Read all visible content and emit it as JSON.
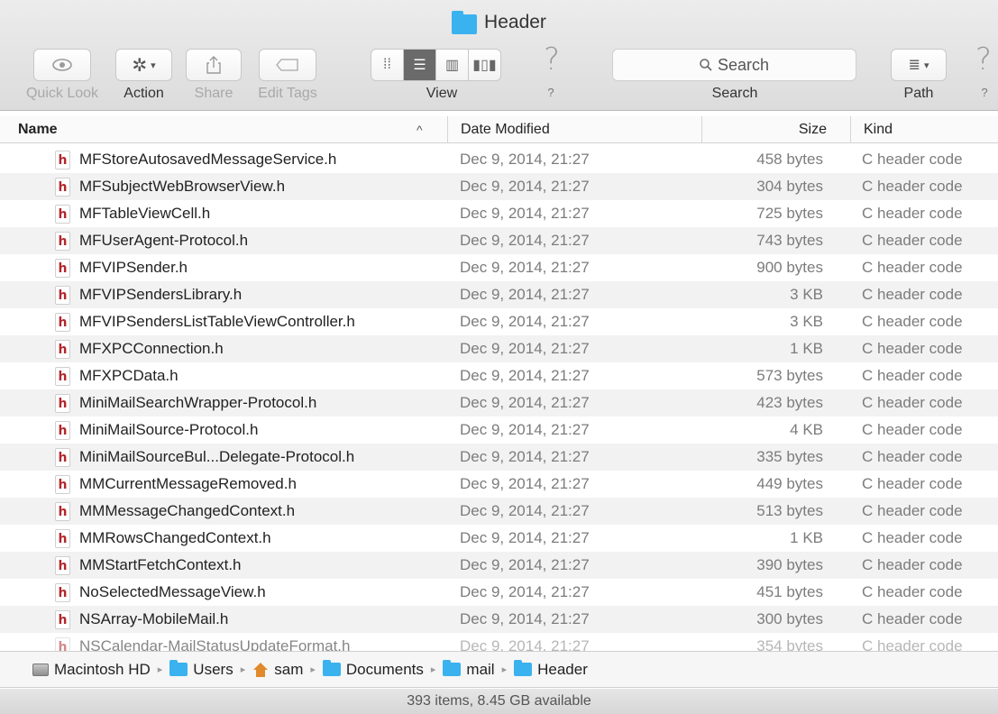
{
  "window": {
    "title": "Header"
  },
  "toolbar": {
    "quick_look_label": "Quick Look",
    "action_label": "Action",
    "share_label": "Share",
    "edit_tags_label": "Edit Tags",
    "view_label": "View",
    "help1_label": "?",
    "search_label": "Search",
    "search_placeholder": "Search",
    "path_label": "Path",
    "help2_label": "?",
    "view_modes": [
      "icon-view",
      "list-view",
      "column-view",
      "cover-flow-view"
    ],
    "active_view": "list-view"
  },
  "columns": {
    "name": "Name",
    "date_modified": "Date Modified",
    "size": "Size",
    "kind": "Kind"
  },
  "files": [
    {
      "name": "MFStoreAutosavedMessageService.h",
      "date": "Dec 9, 2014, 21:27",
      "size": "458 bytes",
      "kind": "C header code"
    },
    {
      "name": "MFSubjectWebBrowserView.h",
      "date": "Dec 9, 2014, 21:27",
      "size": "304 bytes",
      "kind": "C header code"
    },
    {
      "name": "MFTableViewCell.h",
      "date": "Dec 9, 2014, 21:27",
      "size": "725 bytes",
      "kind": "C header code"
    },
    {
      "name": "MFUserAgent-Protocol.h",
      "date": "Dec 9, 2014, 21:27",
      "size": "743 bytes",
      "kind": "C header code"
    },
    {
      "name": "MFVIPSender.h",
      "date": "Dec 9, 2014, 21:27",
      "size": "900 bytes",
      "kind": "C header code"
    },
    {
      "name": "MFVIPSendersLibrary.h",
      "date": "Dec 9, 2014, 21:27",
      "size": "3 KB",
      "kind": "C header code"
    },
    {
      "name": "MFVIPSendersListTableViewController.h",
      "date": "Dec 9, 2014, 21:27",
      "size": "3 KB",
      "kind": "C header code"
    },
    {
      "name": "MFXPCConnection.h",
      "date": "Dec 9, 2014, 21:27",
      "size": "1 KB",
      "kind": "C header code"
    },
    {
      "name": "MFXPCData.h",
      "date": "Dec 9, 2014, 21:27",
      "size": "573 bytes",
      "kind": "C header code"
    },
    {
      "name": "MiniMailSearchWrapper-Protocol.h",
      "date": "Dec 9, 2014, 21:27",
      "size": "423 bytes",
      "kind": "C header code"
    },
    {
      "name": "MiniMailSource-Protocol.h",
      "date": "Dec 9, 2014, 21:27",
      "size": "4 KB",
      "kind": "C header code"
    },
    {
      "name": "MiniMailSourceBul...Delegate-Protocol.h",
      "date": "Dec 9, 2014, 21:27",
      "size": "335 bytes",
      "kind": "C header code"
    },
    {
      "name": "MMCurrentMessageRemoved.h",
      "date": "Dec 9, 2014, 21:27",
      "size": "449 bytes",
      "kind": "C header code"
    },
    {
      "name": "MMMessageChangedContext.h",
      "date": "Dec 9, 2014, 21:27",
      "size": "513 bytes",
      "kind": "C header code"
    },
    {
      "name": "MMRowsChangedContext.h",
      "date": "Dec 9, 2014, 21:27",
      "size": "1 KB",
      "kind": "C header code"
    },
    {
      "name": "MMStartFetchContext.h",
      "date": "Dec 9, 2014, 21:27",
      "size": "390 bytes",
      "kind": "C header code"
    },
    {
      "name": "NoSelectedMessageView.h",
      "date": "Dec 9, 2014, 21:27",
      "size": "451 bytes",
      "kind": "C header code"
    },
    {
      "name": "NSArray-MobileMail.h",
      "date": "Dec 9, 2014, 21:27",
      "size": "300 bytes",
      "kind": "C header code"
    },
    {
      "name": "NSCalendar-MailStatusUpdateFormat.h",
      "date": "Dec 9, 2014, 21:27",
      "size": "354 bytes",
      "kind": "C header code"
    }
  ],
  "file_icon_glyph": "h",
  "path": [
    {
      "label": "Macintosh HD",
      "icon": "hard-drive-icon"
    },
    {
      "label": "Users",
      "icon": "folder-icon"
    },
    {
      "label": "sam",
      "icon": "home-icon"
    },
    {
      "label": "Documents",
      "icon": "folder-icon"
    },
    {
      "label": "mail",
      "icon": "folder-icon"
    },
    {
      "label": "Header",
      "icon": "folder-icon"
    }
  ],
  "status": "393 items, 8.45 GB available",
  "colors": {
    "folder": "#3ab2ef",
    "header_file": "#b3262b"
  }
}
